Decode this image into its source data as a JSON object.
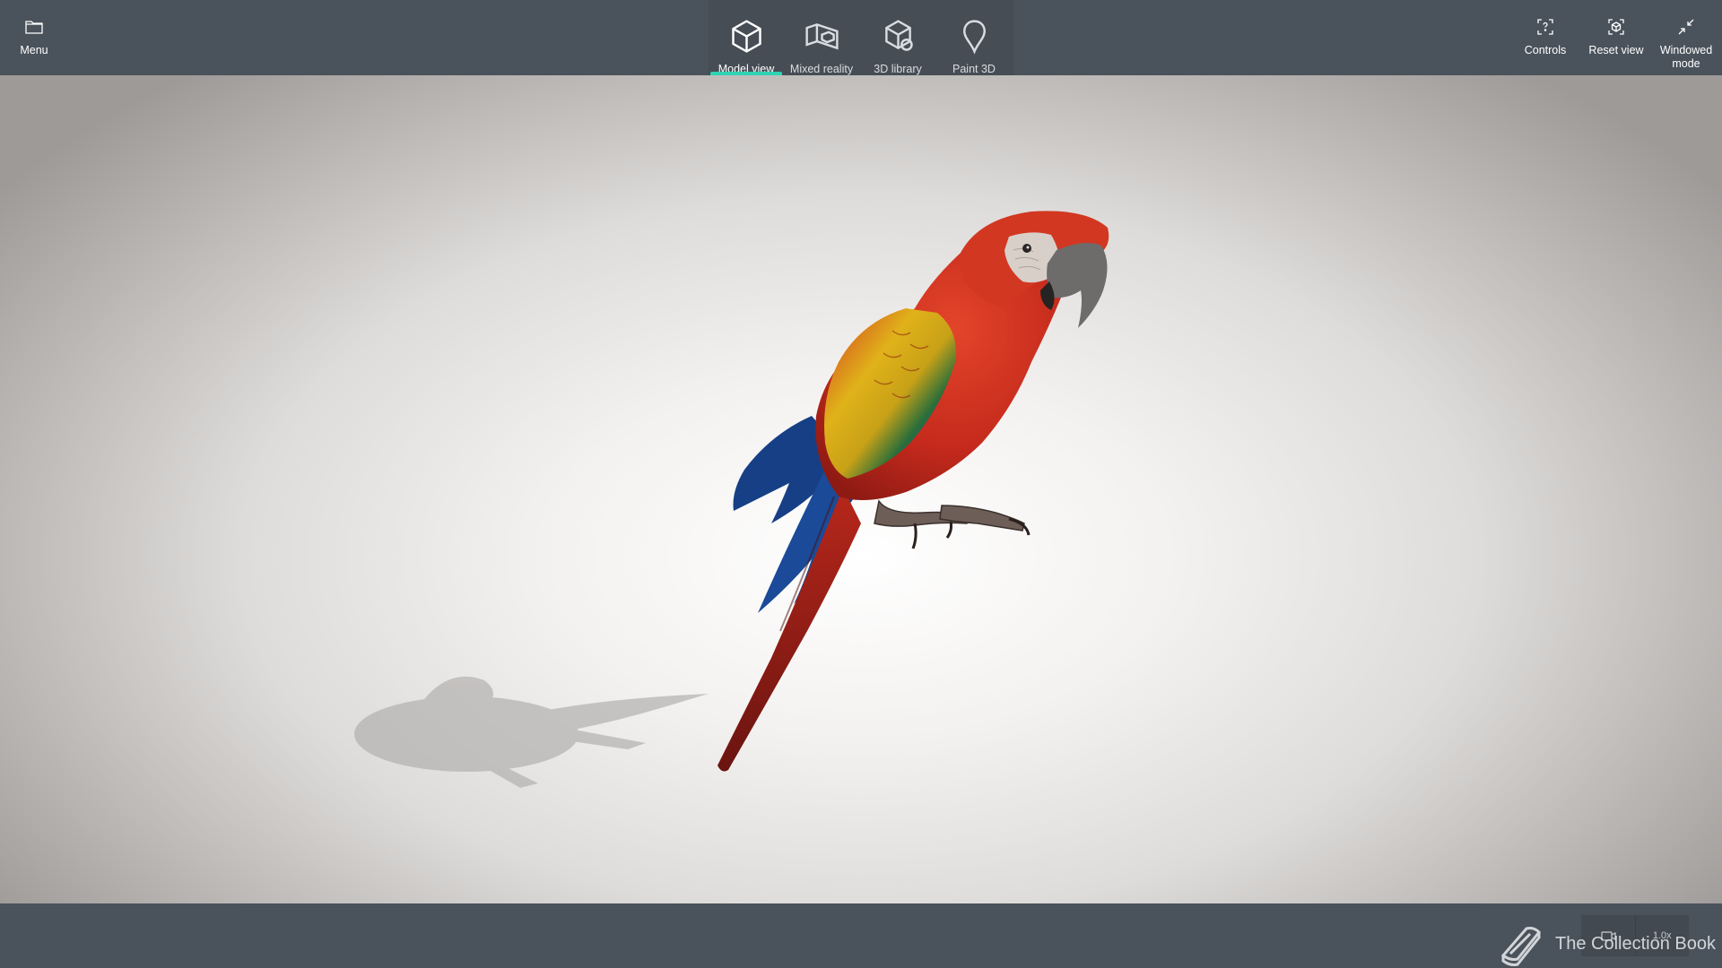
{
  "toolbar": {
    "menu": {
      "label": "Menu",
      "icon": "folder-icon"
    },
    "tabs": [
      {
        "label": "Model view",
        "icon": "cube-icon",
        "active": true
      },
      {
        "label": "Mixed reality",
        "icon": "mixed-reality-icon",
        "active": false
      },
      {
        "label": "3D library",
        "icon": "library-icon",
        "active": false
      },
      {
        "label": "Paint 3D",
        "icon": "paint-icon",
        "active": false
      }
    ],
    "right": [
      {
        "label": "Controls",
        "icon": "controls-help-icon"
      },
      {
        "label": "Reset view",
        "icon": "reset-view-icon"
      },
      {
        "label": "Windowed mode",
        "icon": "windowed-mode-icon"
      }
    ]
  },
  "status": {
    "zoom": "1.0x"
  },
  "watermark": {
    "text": "The Collection Book"
  },
  "colors": {
    "toolbar_bg": "#4a525b",
    "accent": "#2ed3b3"
  }
}
